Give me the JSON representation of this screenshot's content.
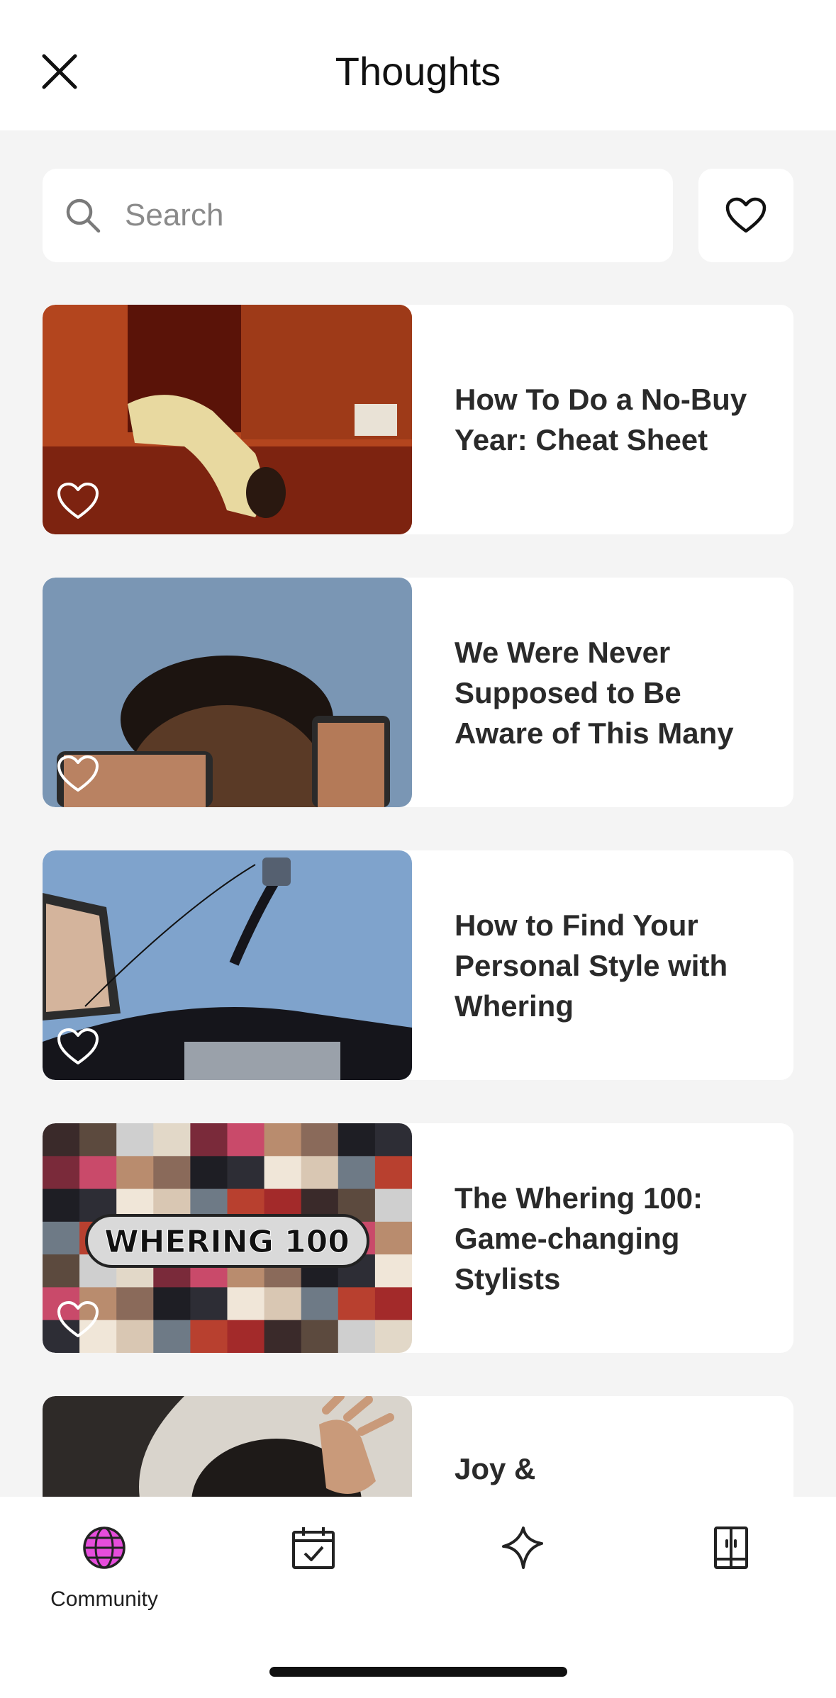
{
  "header": {
    "title": "Thoughts"
  },
  "search": {
    "placeholder": "Search",
    "value": ""
  },
  "articles": [
    {
      "title": "How To Do a No-Buy Year: Cheat Sheet",
      "favorited": false
    },
    {
      "title": "We Were Never Supposed to Be Aware of This Many",
      "favorited": false
    },
    {
      "title": "How to Find Your Personal Style with Whering",
      "favorited": false
    },
    {
      "title": "The Whering 100: Game-changing Stylists",
      "thumb_text": "WHERING 100",
      "favorited": false
    },
    {
      "title": "Joy &",
      "favorited": false
    }
  ],
  "nav": {
    "items": [
      {
        "label": "Community",
        "icon": "globe-icon",
        "active": true
      },
      {
        "label": "",
        "icon": "calendar-check-icon",
        "active": false
      },
      {
        "label": "",
        "icon": "sparkle-icon",
        "active": false
      },
      {
        "label": "",
        "icon": "wardrobe-icon",
        "active": false
      }
    ]
  },
  "colors": {
    "accent": "#e64ddc",
    "background": "#f4f4f4",
    "card": "#ffffff",
    "text": "#2a2a2a"
  }
}
